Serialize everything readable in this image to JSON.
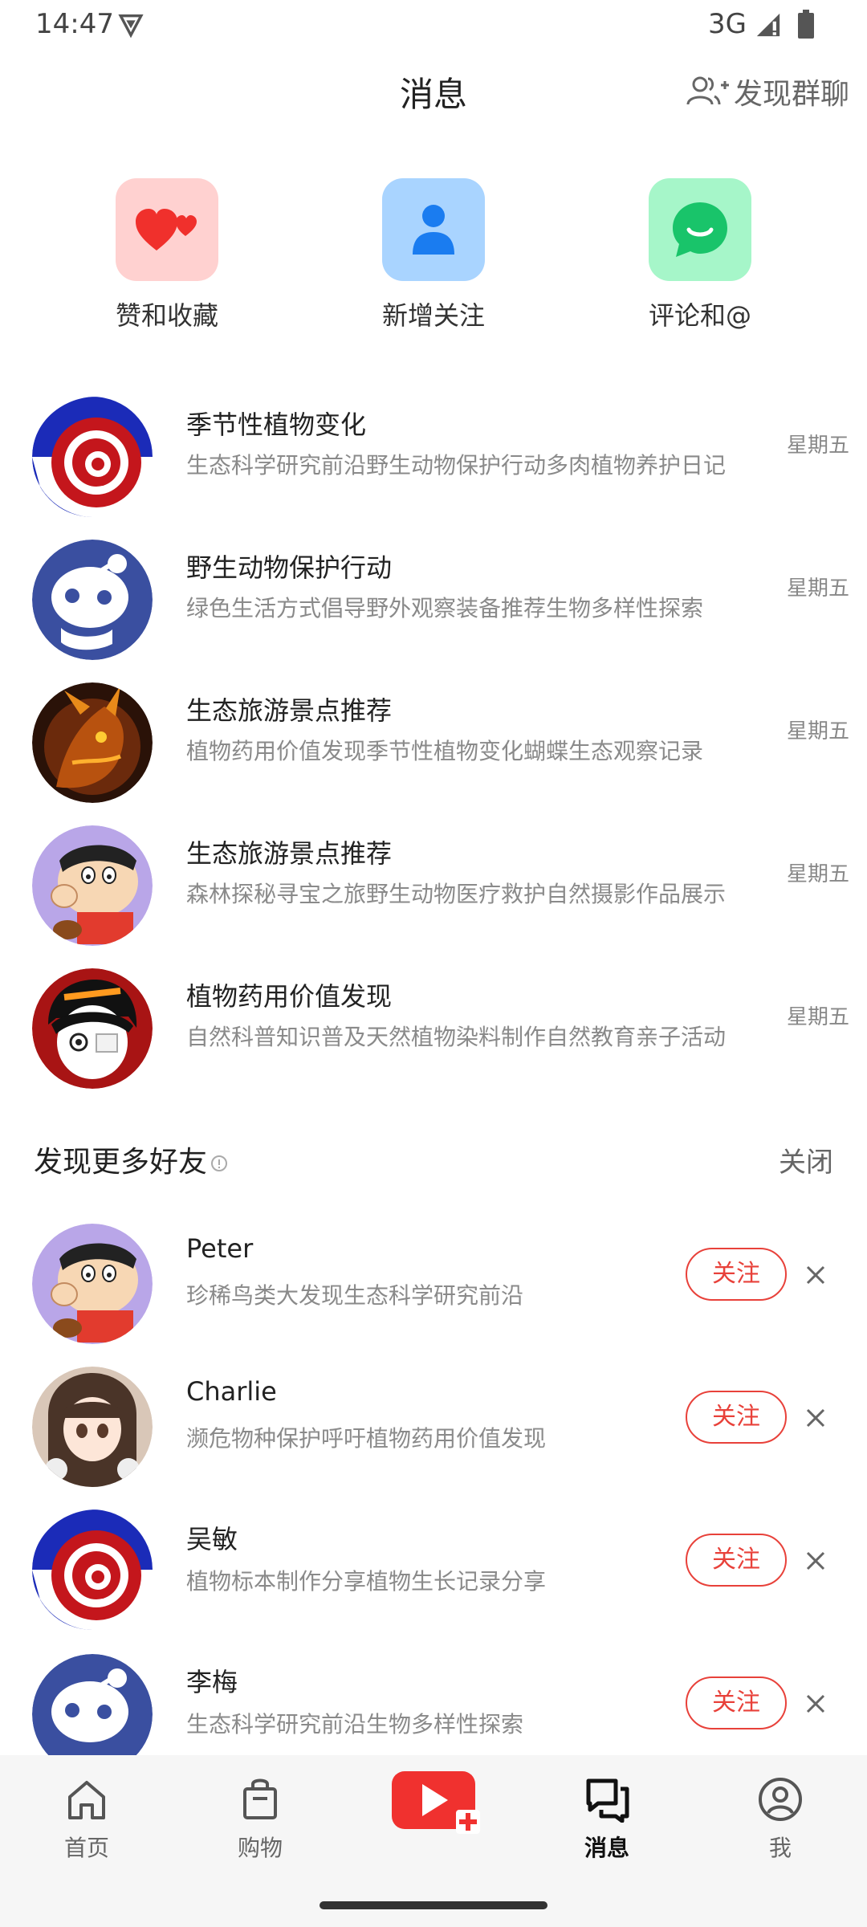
{
  "status_bar": {
    "time": "14:47",
    "network": "3G"
  },
  "header": {
    "title": "消息",
    "discover_group_label": "发现群聊"
  },
  "shortcuts": [
    {
      "label": "赞和收藏",
      "icon": "heart-icon",
      "color": "#ffd1d0"
    },
    {
      "label": "新增关注",
      "icon": "person-icon",
      "color": "#a9d4ff"
    },
    {
      "label": "评论和@",
      "icon": "chat-bubble-icon",
      "color": "#a6f6c9"
    }
  ],
  "messages": [
    {
      "title": "季节性植物变化",
      "subtitle": "生态科学研究前沿野生动物保护行动多肉植物养护日记",
      "time": "星期五",
      "avatar": "swirl-avatar"
    },
    {
      "title": "野生动物保护行动",
      "subtitle": "绿色生活方式倡导野外观察装备推荐生物多样性探索",
      "time": "星期五",
      "avatar": "alien-avatar"
    },
    {
      "title": "生态旅游景点推荐",
      "subtitle": "植物药用价值发现季节性植物变化蝴蝶生态观察记录",
      "time": "星期五",
      "avatar": "dragon-avatar"
    },
    {
      "title": "生态旅游景点推荐",
      "subtitle": "森林探秘寻宝之旅野生动物医疗救护自然摄影作品展示",
      "time": "星期五",
      "avatar": "cartoon-boy-avatar"
    },
    {
      "title": "植物药用价值发现",
      "subtitle": "自然科普知识普及天然植物染料制作自然教育亲子活动",
      "time": "星期五",
      "avatar": "anime-boy-avatar"
    }
  ],
  "recommend": {
    "section_title": "发现更多好友",
    "close_label": "关闭",
    "follow_label": "关注",
    "items": [
      {
        "name": "Peter",
        "desc": "珍稀鸟类大发现生态科学研究前沿",
        "avatar": "cartoon-boy-avatar"
      },
      {
        "name": "Charlie",
        "desc": "濒危物种保护呼吁植物药用价值发现",
        "avatar": "anime-girl-avatar"
      },
      {
        "name": "吴敏",
        "desc": "植物标本制作分享植物生长记录分享",
        "avatar": "swirl-avatar"
      },
      {
        "name": "李梅",
        "desc": "生态科学研究前沿生物多样性探索",
        "avatar": "alien-avatar"
      }
    ]
  },
  "bottom_nav": {
    "items": [
      {
        "label": "首页",
        "icon": "home-icon"
      },
      {
        "label": "购物",
        "icon": "shopping-bag-icon"
      },
      {
        "label": "",
        "icon": "publish-plus-icon"
      },
      {
        "label": "消息",
        "icon": "messages-icon",
        "active": true
      },
      {
        "label": "我",
        "icon": "profile-icon"
      }
    ]
  },
  "colors": {
    "accent": "#e8413a",
    "publish": "#f0312f"
  }
}
